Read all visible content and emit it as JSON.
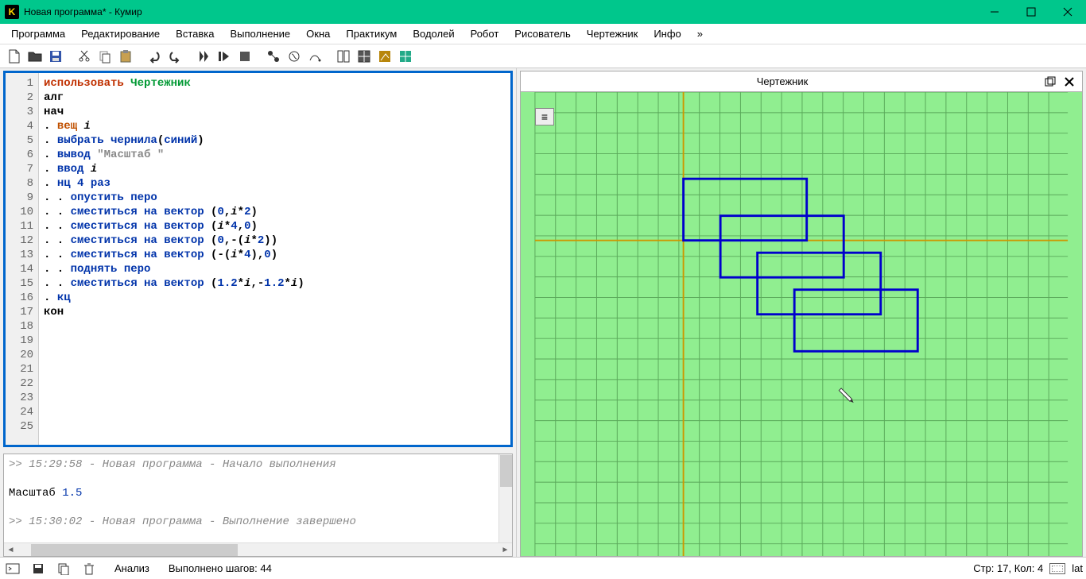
{
  "title": "Новая программа* - Кумир",
  "app_icon_letter": "K",
  "menu": [
    "Программа",
    "Редактирование",
    "Вставка",
    "Выполнение",
    "Окна",
    "Практикум",
    "Водолей",
    "Робот",
    "Рисователь",
    "Чертежник",
    "Инфо",
    "»"
  ],
  "code_lines": [
    {
      "n": 1,
      "html": "<span class='kw-use'>использовать</span> <span class='kw-name'>Чертежник</span>"
    },
    {
      "n": 2,
      "html": "<span class='kw-alg'>алг</span>"
    },
    {
      "n": 3,
      "html": "<span class='kw-alg'>нач</span>"
    },
    {
      "n": 4,
      "html": ". <span class='kw-type'>вещ</span> <span class='kw-var'>i</span>"
    },
    {
      "n": 5,
      "html": ". <span class='kw-stmt'>выбрать чернила</span>(<span class='kw-blue'>синий</span>)"
    },
    {
      "n": 6,
      "html": ". <span class='kw-stmt'>вывод</span> <span class='kw-str'>\"Масштаб \"</span>"
    },
    {
      "n": 7,
      "html": ". <span class='kw-stmt'>ввод</span> <span class='kw-var'>i</span>"
    },
    {
      "n": 8,
      "html": ". <span class='kw-stmt'>нц</span> <span class='kw-num'>4</span> <span class='kw-stmt'>раз</span>"
    },
    {
      "n": 9,
      "html": ". . <span class='kw-stmt'>опустить перо</span>"
    },
    {
      "n": 10,
      "html": ". . <span class='kw-stmt'>сместиться на вектор</span> (<span class='kw-num'>0</span>,<span class='kw-var'>i</span>*<span class='kw-num'>2</span>)"
    },
    {
      "n": 11,
      "html": ". . <span class='kw-stmt'>сместиться на вектор</span> (<span class='kw-var'>i</span>*<span class='kw-num'>4</span>,<span class='kw-num'>0</span>)"
    },
    {
      "n": 12,
      "html": ". . <span class='kw-stmt'>сместиться на вектор</span> (<span class='kw-num'>0</span>,-(<span class='kw-var'>i</span>*<span class='kw-num'>2</span>))"
    },
    {
      "n": 13,
      "html": ". . <span class='kw-stmt'>сместиться на вектор</span> (-(<span class='kw-var'>i</span>*<span class='kw-num'>4</span>),<span class='kw-num'>0</span>)"
    },
    {
      "n": 14,
      "html": ". . <span class='kw-stmt'>поднять перо</span>"
    },
    {
      "n": 15,
      "html": ". . <span class='kw-stmt'>сместиться на вектор</span> (<span class='kw-num'>1.2</span>*<span class='kw-var'>i</span>,-<span class='kw-num'>1.2</span>*<span class='kw-var'>i</span>)"
    },
    {
      "n": 16,
      "html": ". <span class='kw-stmt'>кц</span>"
    },
    {
      "n": 17,
      "html": "<span class='kw-alg'>кон</span>"
    }
  ],
  "extra_line_count": 8,
  "console": {
    "log1": ">> 15:29:58 - Новая программа - Начало выполнения",
    "out_label": "Масштаб ",
    "out_value": "1.5",
    "log2": ">> 15:30:02 - Новая программа - Выполнение завершено"
  },
  "panel_title": "Чертежник",
  "status": {
    "analysis": "Анализ",
    "steps": "Выполнено шагов: 44",
    "pos": "Стр: 17, Кол: 4",
    "lang": "lat"
  },
  "chart_data": {
    "type": "line",
    "description": "4 blue rectangles drawn on green grid, each offset diagonally",
    "origin_note": "Yellow axes cross near upper-left area; rectangles width=i*4, height=i*2 with i=1.5, each shifted by (1.2*i,-1.2*i)",
    "rectangles": [
      {
        "x": 0,
        "y": 0,
        "w": 6,
        "h": 3
      },
      {
        "x": 1.8,
        "y": -1.8,
        "w": 6,
        "h": 3
      },
      {
        "x": 3.6,
        "y": -3.6,
        "w": 6,
        "h": 3
      },
      {
        "x": 5.4,
        "y": -5.4,
        "w": 6,
        "h": 3
      }
    ],
    "pen_end": {
      "x": 7.2,
      "y": -7.2
    },
    "grid_color": "#5aa85a",
    "axis_color": "#cc9900",
    "stroke": "#0000cc"
  }
}
